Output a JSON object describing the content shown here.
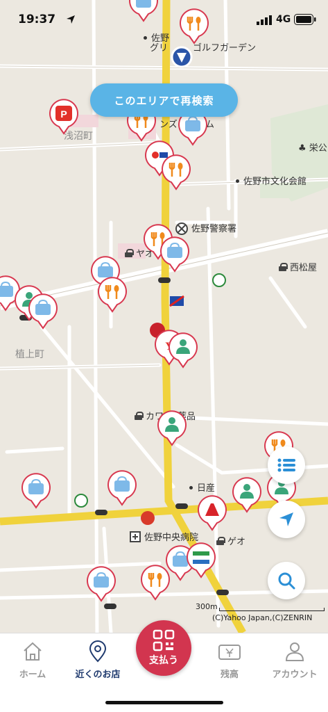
{
  "status": {
    "time": "19:37",
    "network": "4G"
  },
  "map": {
    "research_label": "このエリアで再検索",
    "places": {
      "asanuma": "浅沼町",
      "ueno": "植上町",
      "bunka": "佐野市文化会館",
      "police": "佐野警察署",
      "nishimatsuya": "西松屋",
      "sakae": "栄公",
      "golf": "ゴルフガーデン",
      "sano_green_a": "佐野",
      "sano_green_b": "グリ",
      "yao": "ヤオ",
      "kawachi_a": "カワ",
      "kawachi_b": "薬品",
      "nissan": "日産",
      "geo": "ゲオ",
      "hospital": "佐野中央病院",
      "anzu": "ンズ",
      "anzu_b": "ム"
    },
    "scale": "300m",
    "copyright": "(C)Yahoo Japan,(C)ZENRIN"
  },
  "tabs": {
    "home": "ホーム",
    "nearby": "近くのお店",
    "pay": "支払う",
    "balance": "残高",
    "account": "アカウント"
  },
  "colors": {
    "pin_border": "#d8384f",
    "accent": "#5ab4e6",
    "pay": "#d2354f",
    "nav_active": "#1f3a6e"
  }
}
